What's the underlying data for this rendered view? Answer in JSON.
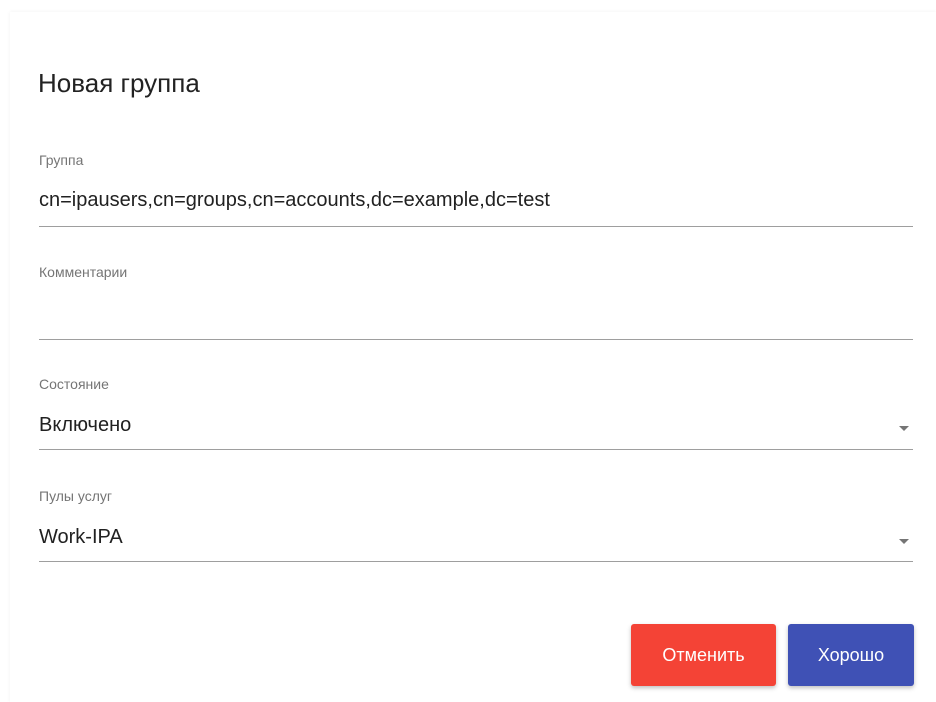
{
  "dialog": {
    "title": "Новая группа"
  },
  "fields": {
    "group": {
      "label": "Группа",
      "value": "cn=ipausers,cn=groups,cn=accounts,dc=example,dc=test"
    },
    "comment": {
      "label": "Комментарии",
      "value": ""
    },
    "state": {
      "label": "Состояние",
      "value": "Включено"
    },
    "service_pools": {
      "label": "Пулы услуг",
      "value": "Work-IPA"
    }
  },
  "actions": {
    "cancel_label": "Отменить",
    "ok_label": "Хорошо"
  },
  "colors": {
    "cancel": "#f44336",
    "ok": "#3f51b5"
  },
  "icons": {
    "dropdown": "chevron-down-icon"
  }
}
